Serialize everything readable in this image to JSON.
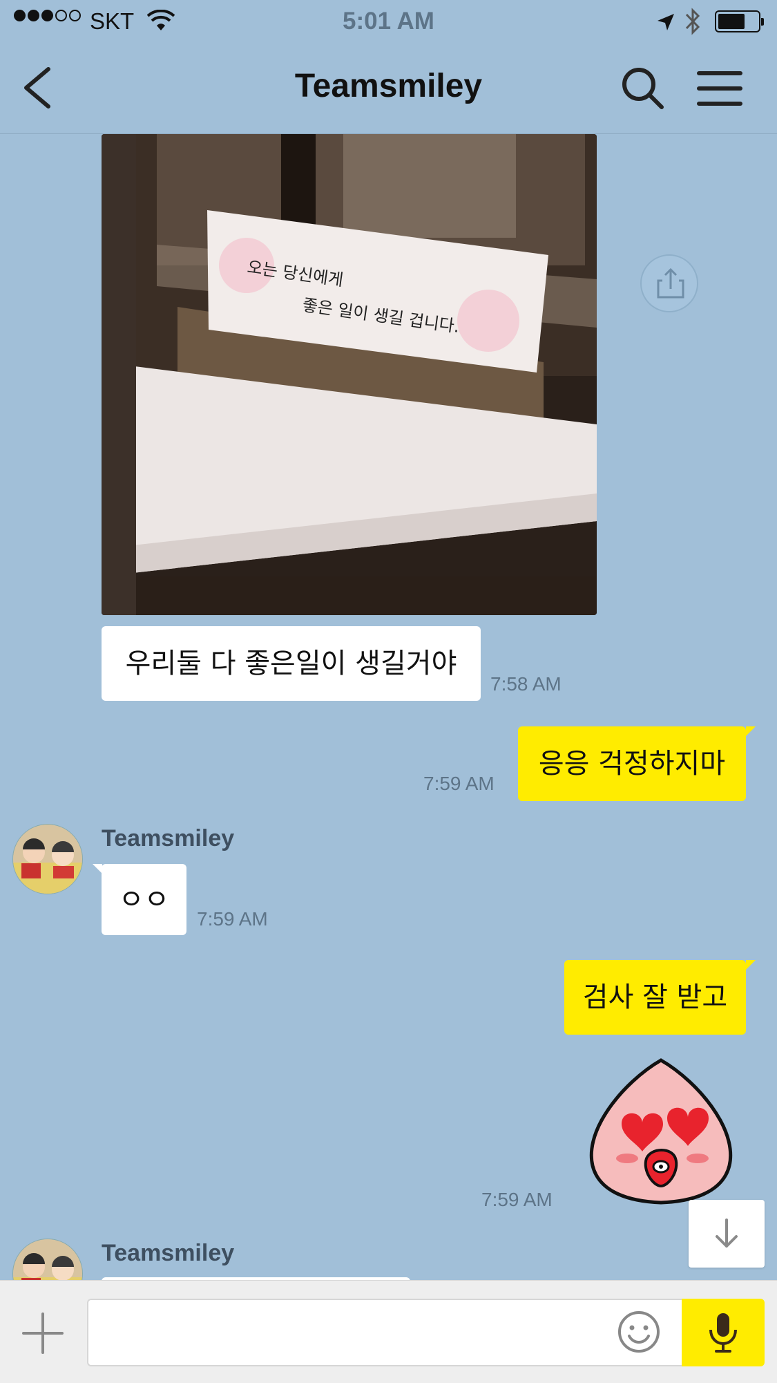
{
  "status_bar": {
    "carrier": "SKT",
    "time": "5:01 AM",
    "signal_bars": 3,
    "signal_total": 5,
    "battery_level": 0.6
  },
  "header": {
    "title": "Teamsmiley",
    "back_icon": "chevron-left-icon",
    "search_icon": "search-icon",
    "menu_icon": "hamburger-menu-icon"
  },
  "messages": [
    {
      "type": "photo",
      "from": "them",
      "photo_text": [
        "오는 당신에게",
        "좋은 일이 생길 겁니다."
      ]
    },
    {
      "type": "text",
      "from": "them",
      "text": "우리둘 다 좋은일이 생길거야",
      "time": "7:58 AM"
    },
    {
      "type": "text",
      "from": "me",
      "text": "응응 걱정하지마",
      "time": "7:59 AM"
    },
    {
      "type": "text",
      "from": "them",
      "sender": "Teamsmiley",
      "text": "ㅇㅇ",
      "time": "7:59 AM"
    },
    {
      "type": "text",
      "from": "me",
      "text": "검사 잘 받고"
    },
    {
      "type": "sticker",
      "from": "me",
      "sticker": "peach-heart-eyes-sticker",
      "time": "7:59 AM"
    },
    {
      "type": "text",
      "from": "them",
      "sender": "Teamsmiley",
      "text": ""
    }
  ],
  "input": {
    "placeholder": "",
    "plus_icon": "plus-icon",
    "emoji_icon": "emoji-icon",
    "mic_icon": "microphone-icon"
  },
  "colors": {
    "background": "#a1bfd8",
    "my_bubble": "#ffec00",
    "their_bubble": "#ffffff",
    "mic_button": "#ffec00"
  }
}
